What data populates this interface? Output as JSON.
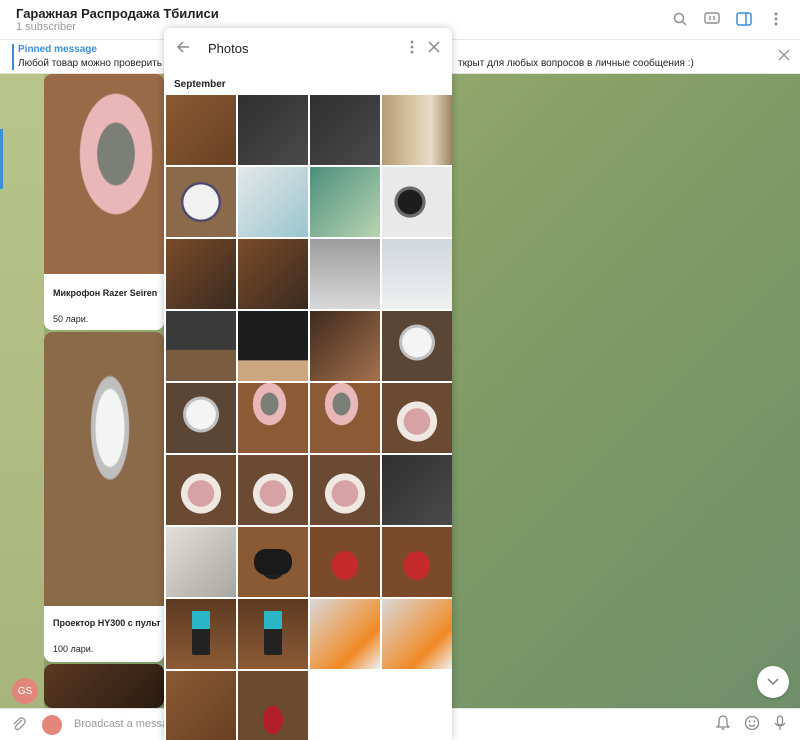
{
  "header": {
    "title": "Гаражная Распродажа Тбилиси",
    "subtitle": "1 subscriber",
    "icons": [
      "search-icon",
      "video-chat-icon",
      "sidebar-toggle-icon",
      "more-icon"
    ]
  },
  "pinned": {
    "label": "Pinned message",
    "text_left": "Любой товар можно проверить",
    "text_right": "ткрыт для любых вопросов в личные сообщения :)"
  },
  "posts": [
    {
      "caption": "Микрофон Razer Seiren",
      "price": "50 лари."
    },
    {
      "caption": "Проектор HY300 с пульт",
      "price": "100 лари."
    }
  ],
  "avatar_text": "GS",
  "input": {
    "placeholder": "Broadcast a message..."
  },
  "photos_panel": {
    "title": "Photos",
    "section": "September",
    "tiles": [
      "t-wood",
      "t-dark",
      "t-dark",
      "t-door",
      "t-ball",
      "t-box",
      "t-bat",
      "t-lens",
      "t-cam",
      "t-cam",
      "t-printer",
      "t-white",
      "t-sound",
      "t-tv",
      "t-desk",
      "t-proj",
      "t-proj",
      "t-mic",
      "t-mic",
      "t-phones",
      "t-phones",
      "t-phones",
      "t-phones",
      "t-dark",
      "t-glove",
      "t-pad",
      "t-redpad",
      "t-redpad",
      "t-usb",
      "t-usb",
      "t-box2",
      "t-box2",
      "t-wood",
      "t-guitar"
    ]
  },
  "colors": {
    "accent": "#3a8fd8",
    "chat_bg": "#8ea46a"
  }
}
